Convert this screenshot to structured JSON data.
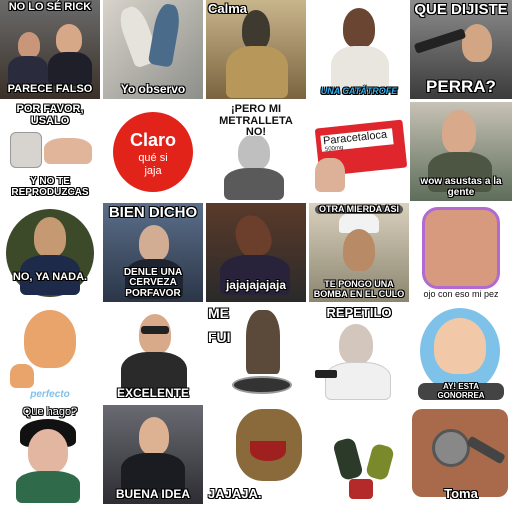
{
  "stickers": [
    {
      "name": "sticker-no-lo-se-rick",
      "top": "NO LO SÉ RICK",
      "bottom": "PARECE FALSO"
    },
    {
      "name": "sticker-yo-observo",
      "bottom": "Yo observo"
    },
    {
      "name": "sticker-calma",
      "top": "Calma"
    },
    {
      "name": "sticker-una-catastrofe",
      "bottom": "UNA CATÁTROFE"
    },
    {
      "name": "sticker-que-dijiste-perra",
      "top": "QUE DIJISTE",
      "bottom": "PERRA?"
    },
    {
      "name": "sticker-por-favor-usalo",
      "top": "POR FAVOR, USALO",
      "bottom": "Y NO TE REPRODUZCAS"
    },
    {
      "name": "sticker-claro-que-si",
      "logo_line1": "Claro",
      "logo_line2": "qué si",
      "logo_line3": "jaja"
    },
    {
      "name": "sticker-pero-mi-metralleta",
      "top": "¡PERO MI METRALLETA NO!"
    },
    {
      "name": "sticker-paracetaloca",
      "label": "Paracetaloca",
      "label_sub": "500mg"
    },
    {
      "name": "sticker-wow-asustas",
      "bottom": "wow asustas a la gente"
    },
    {
      "name": "sticker-no-ya-nada",
      "bottom": "NO, YA NADA."
    },
    {
      "name": "sticker-bien-dicho",
      "top": "BIEN DICHO",
      "bottom": "DENLE UNA CERVEZA PORFAVOR"
    },
    {
      "name": "sticker-jajajajaja",
      "bottom": "jajajajajaja"
    },
    {
      "name": "sticker-bomba-en-el-culo",
      "top": "OTRA MIERDA ASI",
      "bottom": "TE PONGO UNA BOMBA EN EL CULO"
    },
    {
      "name": "sticker-oj-con-eso",
      "bottom": "ojo con eso mi pez"
    },
    {
      "name": "sticker-perfecto",
      "bottom": "perfecto"
    },
    {
      "name": "sticker-excelente",
      "bottom": "EXCELENTE"
    },
    {
      "name": "sticker-me-fui",
      "top": "ME",
      "middle": "FUI"
    },
    {
      "name": "sticker-repetilo",
      "top": "REPETILO"
    },
    {
      "name": "sticker-ay-esta-gonorrea",
      "bottom": "AY! ESTA GONORREA"
    },
    {
      "name": "sticker-que-hago",
      "top": "Que hago?"
    },
    {
      "name": "sticker-buena-idea",
      "bottom": "BUENA IDEA"
    },
    {
      "name": "sticker-jajaja",
      "bottom": "JAJAJA."
    },
    {
      "name": "sticker-robot-dance"
    },
    {
      "name": "sticker-toma",
      "bottom": "Toma"
    }
  ],
  "colors": {
    "claro_red": "#e2231a",
    "paracetaloca_red": "#e0262d",
    "baby_skin": "#e9a46c",
    "sky_blue": "#7fc2e9"
  }
}
